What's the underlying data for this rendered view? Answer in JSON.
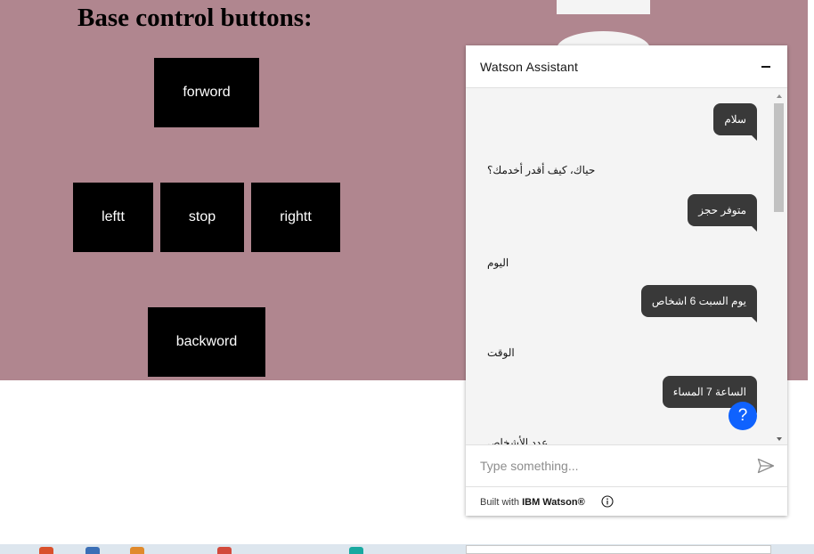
{
  "page": {
    "heading": "Base control buttons:",
    "buttons": {
      "forward": "forword",
      "left": "leftt",
      "stop": "stop",
      "right": "rightt",
      "backward": "backword"
    }
  },
  "chat": {
    "title": "Watson Assistant",
    "messages": [
      {
        "from": "user",
        "text": "سلام"
      },
      {
        "from": "bot",
        "text": "حياك، كيف أقدر أخدمك؟"
      },
      {
        "from": "user",
        "text": "متوفر حجز"
      },
      {
        "from": "bot",
        "text": "اليوم"
      },
      {
        "from": "user",
        "text": "يوم السبت 6 اشخاص"
      },
      {
        "from": "bot",
        "text": "الوقت"
      },
      {
        "from": "user",
        "text": "الساعة 7 المساء"
      },
      {
        "from": "bot",
        "text": "عدد الأشخاص"
      }
    ],
    "help_label": "?",
    "input_placeholder": "Type something...",
    "footer": {
      "prefix": "Built with ",
      "brand": "IBM Watson®"
    }
  },
  "icons": {
    "minimize": "minimize-icon",
    "send": "send-icon",
    "info": "info-icon",
    "help": "help-icon"
  },
  "colors": {
    "page_background": "#b0868f",
    "control_button": "#000000",
    "user_bubble": "#393939",
    "help_button": "#0f62fe"
  }
}
